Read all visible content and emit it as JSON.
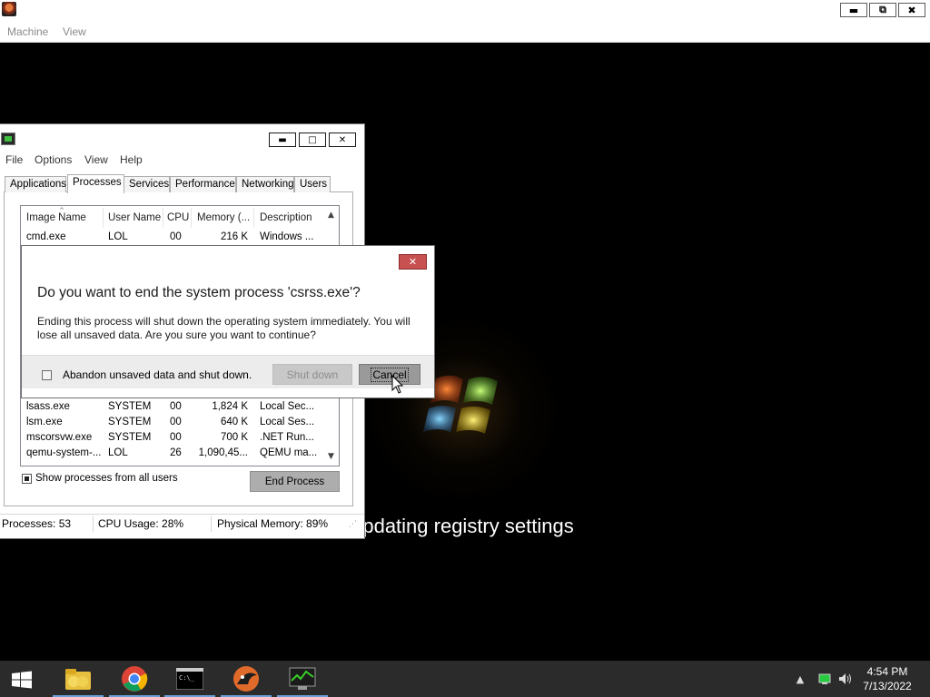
{
  "host": {
    "menu": [
      "Machine",
      "View"
    ],
    "controls": {
      "minimize": "▬",
      "restore": "⧉",
      "close": "✖"
    }
  },
  "boot": {
    "status_text": "s updating registry settings"
  },
  "taskmgr": {
    "menu": [
      "File",
      "Options",
      "View",
      "Help"
    ],
    "controls": {
      "minimize": "▬",
      "maximize": "□",
      "close": "✕"
    },
    "tabs": [
      "Applications",
      "Processes",
      "Services",
      "Performance",
      "Networking",
      "Users"
    ],
    "active_tab": "Processes",
    "columns": [
      "Image Name",
      "User Name",
      "CPU",
      "Memory (...",
      "Description"
    ],
    "rows": [
      {
        "name": "cmd.exe",
        "user": "LOL",
        "cpu": "00",
        "mem": "216 K",
        "desc": "Windows ..."
      },
      {
        "name": "lsass.exe",
        "user": "SYSTEM",
        "cpu": "00",
        "mem": "1,824 K",
        "desc": "Local Sec..."
      },
      {
        "name": "lsm.exe",
        "user": "SYSTEM",
        "cpu": "00",
        "mem": "640 K",
        "desc": "Local Ses..."
      },
      {
        "name": "mscorsvw.exe",
        "user": "SYSTEM",
        "cpu": "00",
        "mem": "700 K",
        "desc": ".NET Run..."
      },
      {
        "name": "qemu-system-...",
        "user": "LOL",
        "cpu": "26",
        "mem": "1,090,45...",
        "desc": "QEMU ma..."
      }
    ],
    "show_all_label": "Show processes from all users",
    "show_all_checked": true,
    "end_process_label": "End Process",
    "status": {
      "processes": "Processes: 53",
      "cpu": "CPU Usage: 28%",
      "memory": "Physical Memory: 89%"
    }
  },
  "dialog": {
    "close": "✕",
    "heading": "Do you want to end the system process 'csrss.exe'?",
    "body": "Ending this process will shut down the operating system immediately.  You will lose all unsaved data.  Are you sure you want to continue?",
    "checkbox_label": "Abandon unsaved data and shut down.",
    "checkbox_checked": false,
    "shutdown_label": "Shut down",
    "cancel_label": "Cancel"
  },
  "taskbar": {
    "pinned": [
      "windows-explorer-icon",
      "chrome-icon",
      "cmd-icon",
      "qemu-icon",
      "task-manager-icon"
    ],
    "tray": [
      "show-hidden-icons-arrow",
      "network-icon",
      "volume-icon"
    ],
    "time": "4:54 PM",
    "date": "7/13/2022",
    "accent": "#6aa0d8"
  }
}
